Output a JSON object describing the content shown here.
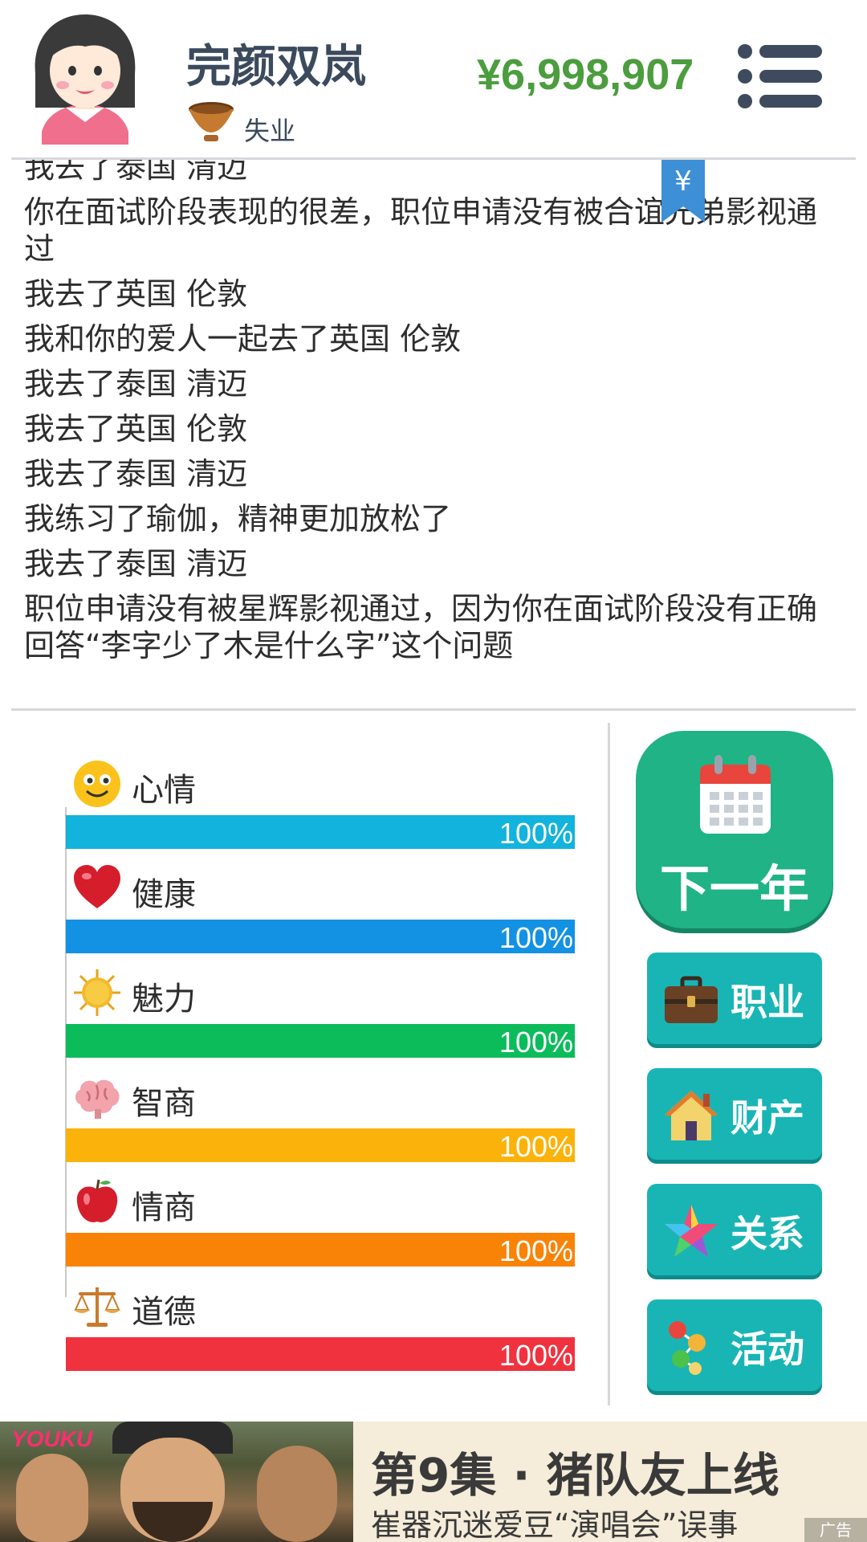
{
  "header": {
    "name": "完颜双岚",
    "job": "失业",
    "money": "¥6,998,907"
  },
  "bookmark": {
    "symbol": "¥"
  },
  "log": {
    "lines": [
      "我去了泰国 清迈",
      "你在面试阶段表现的很差，职位申请没有被合谊兄弟影视通过",
      "我去了英国 伦敦",
      "我和你的爱人一起去了英国 伦敦",
      "我去了泰国 清迈",
      "我去了英国 伦敦",
      "我去了泰国 清迈",
      "我练习了瑜伽，精神更加放松了",
      "我去了泰国 清迈",
      "职位申请没有被星辉影视通过，因为你在面试阶段没有正确回答“李字少了木是什么字”这个问题"
    ]
  },
  "stats": [
    {
      "label": "心情",
      "value": 100,
      "display": "100%",
      "color": "#12b3dc",
      "icon": "smiley-icon"
    },
    {
      "label": "健康",
      "value": 100,
      "display": "100%",
      "color": "#1391e3",
      "icon": "heart-icon"
    },
    {
      "label": "魅力",
      "value": 100,
      "display": "100%",
      "color": "#0cbc5b",
      "icon": "sun-icon"
    },
    {
      "label": "智商",
      "value": 100,
      "display": "100%",
      "color": "#fbb20a",
      "icon": "brain-icon"
    },
    {
      "label": "情商",
      "value": 100,
      "display": "100%",
      "color": "#f98307",
      "icon": "apple-icon"
    },
    {
      "label": "道德",
      "value": 100,
      "display": "100%",
      "color": "#f0323f",
      "icon": "scales-icon"
    }
  ],
  "actions": {
    "next_year": "下一年",
    "career": "职业",
    "property": "财产",
    "relations": "关系",
    "activities": "活动"
  },
  "ad": {
    "logo": "YOUKU",
    "title": "第9集 · 猪队友上线",
    "subtitle": "崔器沉迷爱豆“演唱会”误事",
    "tag": "广告"
  }
}
